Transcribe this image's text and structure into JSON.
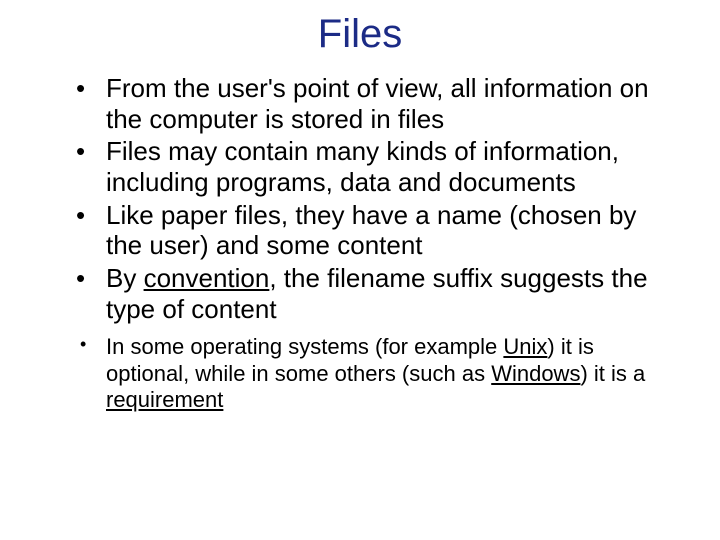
{
  "slide": {
    "title": "Files",
    "bullets": [
      "From the user's point of view, all information on the computer is stored in files",
      "Files may contain many kinds of information, including programs, data and documents",
      "Like paper files, they have a name (chosen by the user) and some content"
    ],
    "bullet4": {
      "pre": "By ",
      "underlined": "convention",
      "post": ", the filename suffix suggests the type of content"
    },
    "sub": {
      "p1": "In some operating systems (for example ",
      "u1": "Unix",
      "p2": ") it is optional, while in some others (such as ",
      "u2": "Windows",
      "p3": ") it is a ",
      "u3": "requirement"
    }
  }
}
